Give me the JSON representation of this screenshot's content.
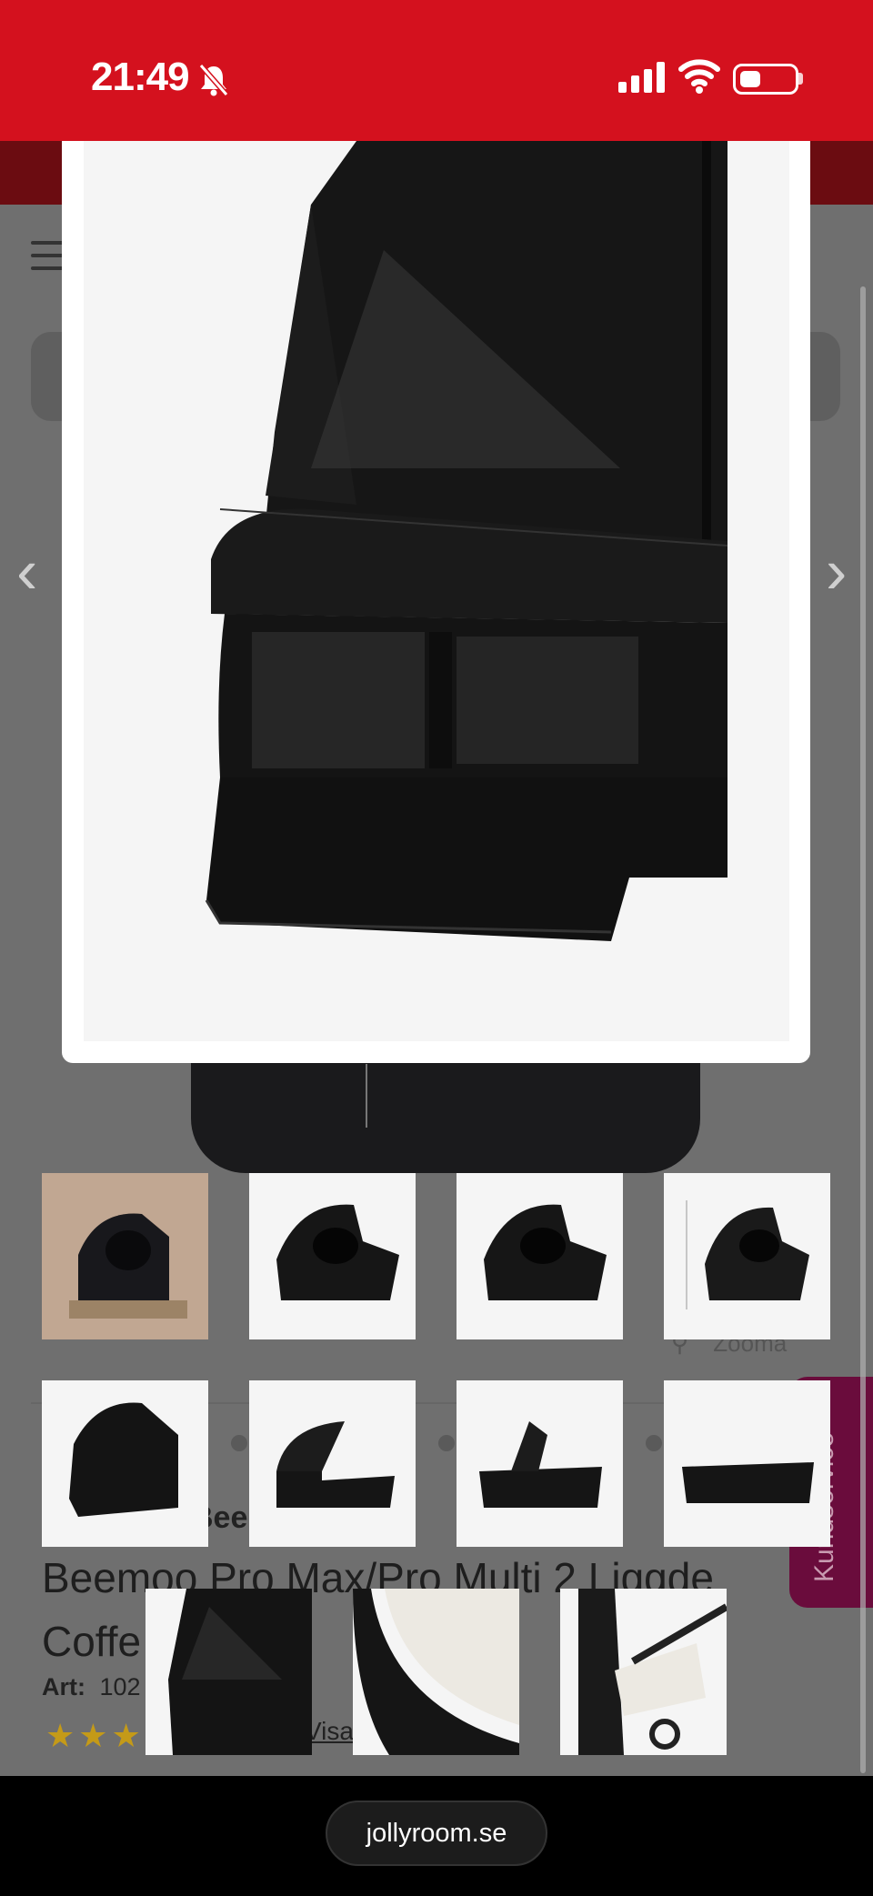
{
  "status_bar": {
    "time": "21:49",
    "background_color": "#d4111e",
    "icons": [
      "bell-slash-icon",
      "cellular-signal-icon",
      "wifi-icon",
      "battery-icon"
    ]
  },
  "page": {
    "zoom_label": "Zooma",
    "brand": "Bee",
    "product_title": "Beemoo Pro Max/Pro Multi 2 Liggde Coffe",
    "article_label": "Art:",
    "article_value": "102",
    "reviews_link": "Visa … ner",
    "customer_service_label": "Kundservice"
  },
  "gallery": {
    "thumbnails": [
      {
        "alt": "bassinet-lifestyle-beige"
      },
      {
        "alt": "bassinet-front-angle"
      },
      {
        "alt": "bassinet-front-angle-2"
      },
      {
        "alt": "bassinet-dimensions"
      },
      {
        "alt": "bassinet-rear-angle"
      },
      {
        "alt": "bassinet-side-hood-half"
      },
      {
        "alt": "bassinet-side-hood-folded"
      },
      {
        "alt": "bassinet-side-no-hood"
      },
      {
        "alt": "bassinet-mesh-closeup"
      },
      {
        "alt": "bassinet-interior-white"
      },
      {
        "alt": "bassinet-on-stroller"
      }
    ]
  },
  "browser": {
    "url": "jollyroom.se"
  }
}
